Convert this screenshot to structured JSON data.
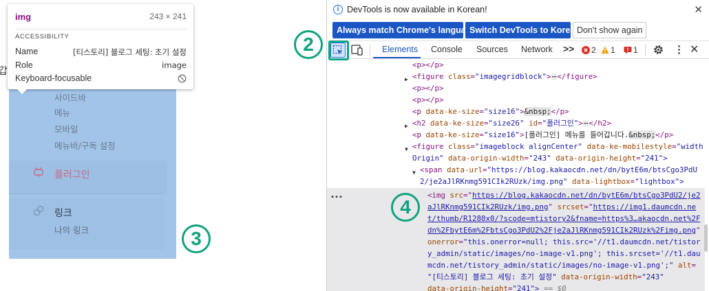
{
  "page": {
    "edge_char": "갑",
    "menu_partial": "사이드바",
    "menu_items": [
      "메뉴",
      "모바일",
      "메뉴바/구독 설정"
    ],
    "plugin_label": "플러그인",
    "link_label": "링크",
    "mylink_label": "나의 링크",
    "marker_3": "3"
  },
  "tooltip": {
    "tag": "img",
    "size": "243 × 241",
    "section": "ACCESSIBILITY",
    "name_key": "Name",
    "name_val": "[티스토리] 블로그 세팅: 초기 설정",
    "role_key": "Role",
    "role_val": "image",
    "kb_key": "Keyboard-focusable"
  },
  "devtools": {
    "info_text": "DevTools is now available in Korean!",
    "btn_match": "Always match Chrome's language",
    "btn_switch": "Switch DevTools to Korean",
    "btn_dontshow": "Don't show again",
    "tabs": {
      "elements": "Elements",
      "console": "Console",
      "sources": "Sources",
      "network": "Network",
      "more": ">>"
    },
    "badges": {
      "errors": "2",
      "warnings": "1",
      "issues": "1"
    },
    "marker_2": "2",
    "marker_4": "4",
    "dom": {
      "l1_p": "<p></p>",
      "l2_fig_attr": "class",
      "l2_fig_val": "\"imagegridblock\"",
      "l3_p": "<p></p>",
      "l4_p": "<p></p>",
      "l5_attr": "data-ke-size",
      "l5_val": "\"size16\"",
      "l5_text": "&nbsp;",
      "l6_attr1": "data-ke-size",
      "l6_val1": "\"size26\"",
      "l6_attr2": "id",
      "l6_val2": "\"플러그인\"",
      "l7_attr": "data-ke-size",
      "l7_val": "\"size16\"",
      "l7_text": "[플러그인] 메뉴를 들어갑니다.",
      "l7_ent": "&nbsp;",
      "l8_attr1": "class",
      "l8_val1": "\"imageblock alignCenter\"",
      "l8_attr2": "data-ke-mobilestyle",
      "l8_val2": "\"width",
      "l9_val2": "Origin\"",
      "l9_attr3": "data-origin-width",
      "l9_val3": "\"243\"",
      "l9_attr4": "data-origin-height",
      "l9_val4": "\"241\">",
      "l10_attr": "data-url",
      "l10_val": "\"https://blog.kakaocdn.net/dn/bytE6m/btsCgo3PdU",
      "l11_val": "2/je2aJlRKnmg591CIk2RUzk/img.png\"",
      "l11_attr2": "data-lightbox",
      "l11_val2": "\"lightbox\">",
      "s1_src_attr": "src",
      "s1_src": "https://blog.kakaocdn.net/dn/bytE6m/btsCgo3PdU2/je2",
      "s2_src": "aJlRKnmg591CIk2RUzk/img.png",
      "s2_srcset_attr": "srcset",
      "s2_srcset": "https://img1.daumcdn.ne",
      "s3_srcset": "t/thumb/R1280x0/?scode=mtistory2&fname=https%3…akaocdn.net%2F",
      "s4_srcset": "dn%2FbytE6m%2FbtsCgo3PdU2%2Fje2aJlRKnmg591CIk2RUzk%2Fimg.png",
      "s5_attr": "onerror",
      "s5_val": "\"this.onerror=null; this.src='//t1.daumcdn.net/tistor",
      "s6_val": "y_admin/static/images/no-image-v1.png'; this.srcset='//t1.dau",
      "s7_val": "mcdn.net/tistory_admin/static/images/no-image-v1.png';\"",
      "s7_alt_attr": "alt",
      "s8_alt": "\"[티스토리] 블로그 세팅: 초기 설정\"",
      "s8_attr2": "data-origin-width",
      "s8_val2": "\"243\"",
      "s9_attr": "data-origin-height",
      "s9_val": "\"241\">",
      "s9_eq": "== $0"
    }
  },
  "colors": {
    "highlight": "#a2c4e8",
    "accent_green": "#10a37f",
    "devtools_blue": "#1a56c4",
    "tag_purple": "#881280",
    "attr_brown": "#994500",
    "value_blue": "#1a1aa6"
  }
}
